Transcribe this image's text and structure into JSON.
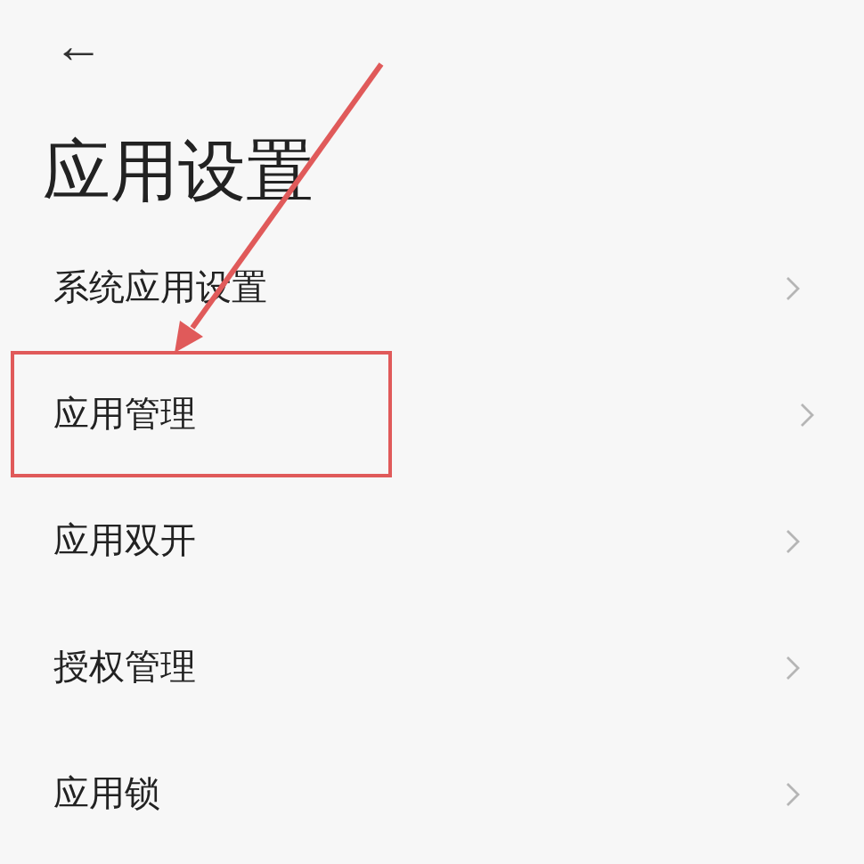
{
  "header": {
    "back": "←",
    "title": "应用设置"
  },
  "items": [
    {
      "label": "系统应用设置",
      "annotated": false
    },
    {
      "label": "应用管理",
      "annotated": true
    },
    {
      "label": "应用双开",
      "annotated": false
    },
    {
      "label": "授权管理",
      "annotated": false
    },
    {
      "label": "应用锁",
      "annotated": false
    }
  ]
}
